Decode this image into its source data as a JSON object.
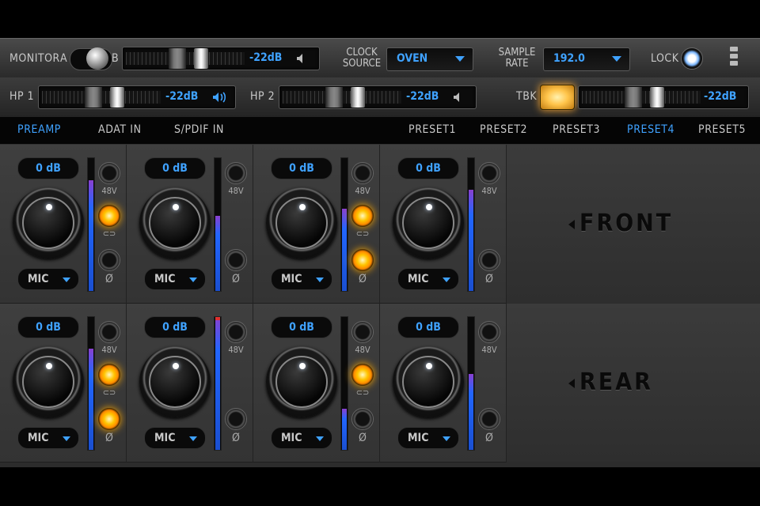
{
  "top": {
    "monitor_label": "MONITOR",
    "a_label": "A",
    "b_label": "B",
    "monitor_level": "-22dB",
    "clock_source_label_1": "CLOCK",
    "clock_source_label_2": "SOURCE",
    "clock_source_value": "OVEN",
    "sample_rate_label_1": "SAMPLE",
    "sample_rate_label_2": "RATE",
    "sample_rate_value": "192.0",
    "lock_label": "LOCK"
  },
  "headphones": {
    "hp1_label": "HP 1",
    "hp1_level": "-22dB",
    "hp2_label": "HP 2",
    "hp2_level": "-22dB",
    "tbk_label": "TBK",
    "tbk_level": "-22dB"
  },
  "nav": {
    "tabs": [
      "PREAMP",
      "ADAT IN",
      "S/PDIF IN"
    ],
    "presets": [
      "PRESET1",
      "PRESET2",
      "PRESET3",
      "PRESET4",
      "PRESET5"
    ],
    "active_tab": "PREAMP",
    "active_preset": "PRESET4"
  },
  "channels": {
    "front": [
      {
        "gain": "0 dB",
        "source": "MIC",
        "label_48v": "48V",
        "phase": "Ø"
      },
      {
        "gain": "0 dB",
        "source": "MIC",
        "label_48v": "48V",
        "phase": "Ø"
      },
      {
        "gain": "0 dB",
        "source": "MIC",
        "label_48v": "48V",
        "phase": "Ø"
      },
      {
        "gain": "0 dB",
        "source": "MIC",
        "label_48v": "48V",
        "phase": "Ø"
      }
    ],
    "rear": [
      {
        "gain": "0 dB",
        "source": "MIC",
        "label_48v": "48V",
        "phase": "Ø"
      },
      {
        "gain": "0 dB",
        "source": "MIC",
        "label_48v": "48V",
        "phase": "Ø"
      },
      {
        "gain": "0 dB",
        "source": "MIC",
        "label_48v": "48V",
        "phase": "Ø"
      },
      {
        "gain": "0 dB",
        "source": "MIC",
        "label_48v": "48V",
        "phase": "Ø"
      }
    ],
    "front_label": "FRONT",
    "rear_label": "REAR"
  },
  "colors": {
    "accent": "#3fa2ff",
    "led_on": "#ffc400"
  }
}
